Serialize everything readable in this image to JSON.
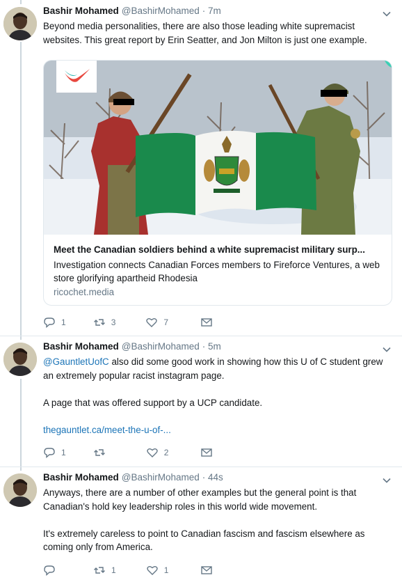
{
  "colors": {
    "link": "#1b74b7",
    "secondary": "#657786",
    "divider": "#e1e8ed",
    "thread_line": "#ccd6dd"
  },
  "tweets": [
    {
      "name": "Bashir Mohamed",
      "handle": "@BashirMohamed",
      "time": "· 7m",
      "text": "Beyond media personalities, there are also those leading white supremacist websites. This great report by Erin Seatter, and Jon Milton is just one example.",
      "card": {
        "title": "Meet the Canadian soldiers behind a white supremacist military surp...",
        "description": "Investigation connects Canadian Forces members to Fireforce Ventures, a web store glorifying apartheid Rhodesia",
        "domain": "ricochet.media"
      },
      "actions": {
        "replies": "1",
        "retweets": "3",
        "likes": "7"
      }
    },
    {
      "name": "Bashir Mohamed",
      "handle": "@BashirMohamed",
      "time": "· 5m",
      "mention": "@GauntletUofC",
      "text_after_mention": " also did some good work in showing how this U of C student grew an extremely popular racist instagram page.",
      "paragraph2": "A page that was offered support by a UCP candidate.",
      "link": "thegauntlet.ca/meet-the-u-of-...",
      "actions": {
        "replies": "1",
        "retweets": "",
        "likes": "2"
      }
    },
    {
      "name": "Bashir Mohamed",
      "handle": "@BashirMohamed",
      "time": "· 44s",
      "paragraph1": "Anyways, there are a number of other examples but the general point is that Canadian's hold key leadership roles in this world wide movement.",
      "paragraph2": "It's extremely careless to point to Canadian fascism and fascism elsewhere as coming only from America.",
      "actions": {
        "replies": "",
        "retweets": "1",
        "likes": "1"
      }
    }
  ]
}
